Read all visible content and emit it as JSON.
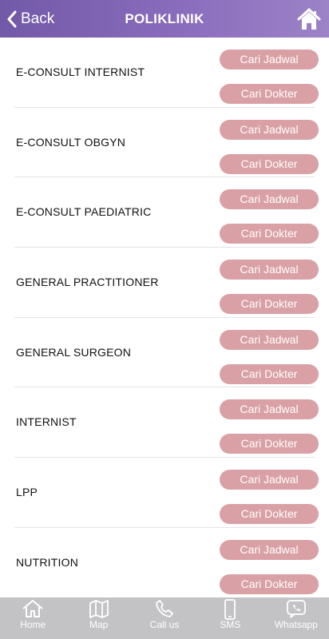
{
  "header": {
    "back_label": "Back",
    "title": "POLIKLINIK"
  },
  "clinics": [
    {
      "name": "E-CONSULT INTERNIST"
    },
    {
      "name": "E-CONSULT OBGYN"
    },
    {
      "name": "E-CONSULT PAEDIATRIC"
    },
    {
      "name": "GENERAL PRACTITIONER"
    },
    {
      "name": "GENERAL SURGEON"
    },
    {
      "name": "INTERNIST"
    },
    {
      "name": "LPP"
    },
    {
      "name": "NUTRITION"
    }
  ],
  "buttons": {
    "schedule_label": "Cari Jadwal",
    "doctor_label": "Cari Dokter"
  },
  "tabbar": [
    {
      "label": "Home",
      "icon": "home-icon"
    },
    {
      "label": "Map",
      "icon": "map-icon"
    },
    {
      "label": "Call us",
      "icon": "phone-icon"
    },
    {
      "label": "SMS",
      "icon": "mobile-icon"
    },
    {
      "label": "Whatsapp",
      "icon": "chat-icon"
    }
  ],
  "colors": {
    "header_start": "#7259a8",
    "header_end": "#9c83c7",
    "button": "#d9a0a5",
    "tabbar": "#c3c3c6"
  }
}
